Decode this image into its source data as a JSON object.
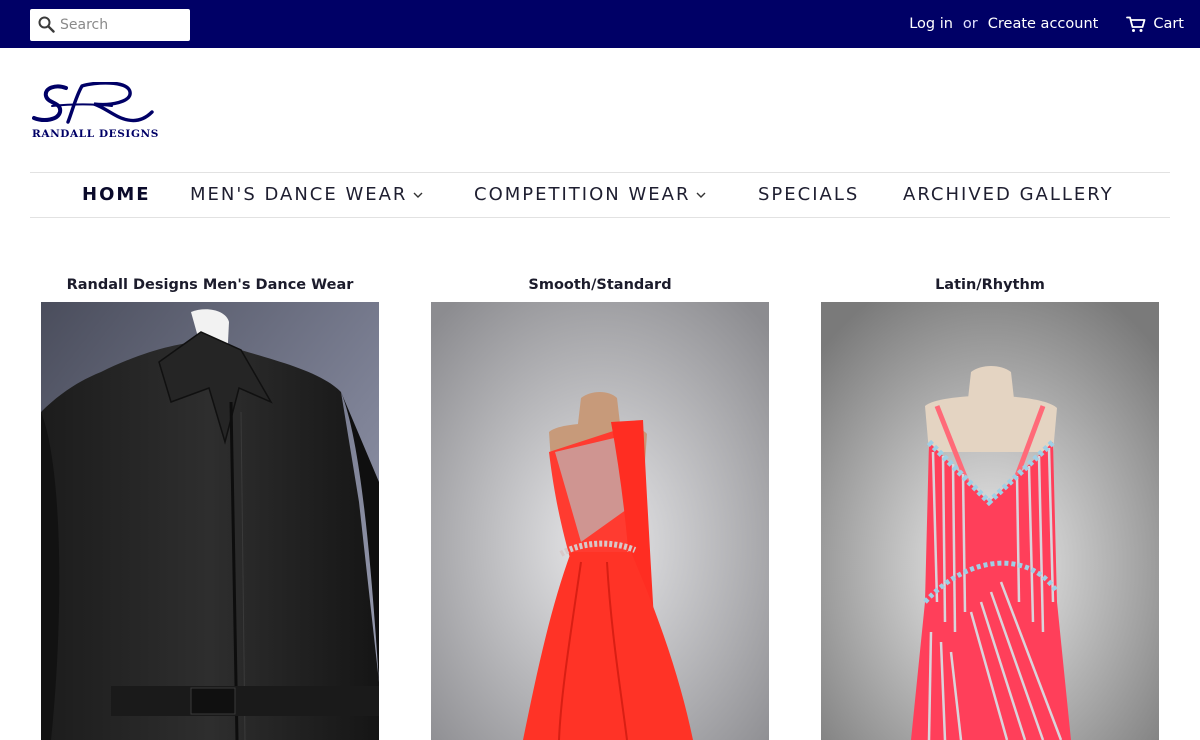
{
  "header": {
    "search_placeholder": "Search",
    "login": "Log in",
    "or": "or",
    "create_account": "Create account",
    "cart": "Cart"
  },
  "logo": {
    "text": "RANDALL DESIGNS"
  },
  "nav": {
    "items": [
      {
        "label": "HOME"
      },
      {
        "label": "MEN'S DANCE WEAR"
      },
      {
        "label": "COMPETITION WEAR"
      },
      {
        "label": "SPECIALS"
      },
      {
        "label": "ARCHIVED GALLERY"
      }
    ]
  },
  "collections": [
    {
      "title": "Randall Designs Men's Dance Wear"
    },
    {
      "title": "Smooth/Standard"
    },
    {
      "title": "Latin/Rhythm"
    }
  ],
  "colors": {
    "topbar": "#000066",
    "brand": "#000066"
  },
  "icons": [
    "search-icon",
    "cart-icon",
    "chevron-down-icon"
  ]
}
